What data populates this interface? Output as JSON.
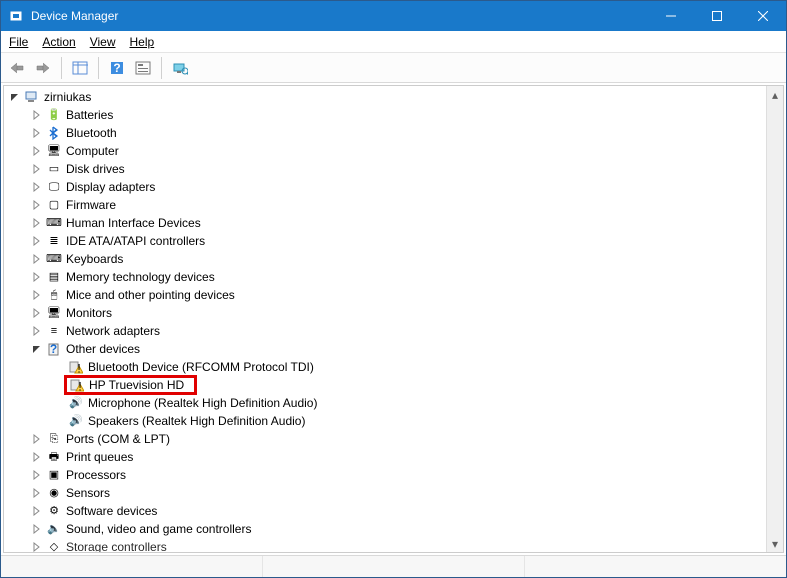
{
  "title": "Device Manager",
  "menus": {
    "file": "File",
    "action": "Action",
    "view": "View",
    "help": "Help"
  },
  "root": "zirniukas",
  "categories": [
    {
      "id": "batteries",
      "label": "Batteries",
      "icon": "battery-icon"
    },
    {
      "id": "bluetooth",
      "label": "Bluetooth",
      "icon": "bluetooth-icon"
    },
    {
      "id": "computer",
      "label": "Computer",
      "icon": "monitor-icon"
    },
    {
      "id": "diskdrives",
      "label": "Disk drives",
      "icon": "drive-icon"
    },
    {
      "id": "displayadapters",
      "label": "Display adapters",
      "icon": "display-adapter-icon"
    },
    {
      "id": "firmware",
      "label": "Firmware",
      "icon": "chip-icon"
    },
    {
      "id": "hid",
      "label": "Human Interface Devices",
      "icon": "hid-icon"
    },
    {
      "id": "ide",
      "label": "IDE ATA/ATAPI controllers",
      "icon": "ide-icon"
    },
    {
      "id": "keyboards",
      "label": "Keyboards",
      "icon": "keyboard-icon"
    },
    {
      "id": "memtech",
      "label": "Memory technology devices",
      "icon": "memory-icon"
    },
    {
      "id": "mice",
      "label": "Mice and other pointing devices",
      "icon": "mouse-icon"
    },
    {
      "id": "monitors",
      "label": "Monitors",
      "icon": "monitor-icon"
    },
    {
      "id": "network",
      "label": "Network adapters",
      "icon": "network-icon"
    },
    {
      "id": "other",
      "label": "Other devices",
      "icon": "question-icon",
      "open": true,
      "children": [
        {
          "id": "bt-rfcomm",
          "label": "Bluetooth Device (RFCOMM Protocol TDI)",
          "icon": "warning-icon"
        },
        {
          "id": "hp-truevision",
          "label": "HP Truevision HD",
          "icon": "warning-icon",
          "highlighted": true
        },
        {
          "id": "mic-realtek",
          "label": "Microphone (Realtek High Definition Audio)",
          "icon": "speaker-icon"
        },
        {
          "id": "spk-realtek",
          "label": "Speakers (Realtek High Definition Audio)",
          "icon": "speaker-icon"
        }
      ]
    },
    {
      "id": "ports",
      "label": "Ports (COM & LPT)",
      "icon": "port-icon"
    },
    {
      "id": "printq",
      "label": "Print queues",
      "icon": "printer-icon"
    },
    {
      "id": "processors",
      "label": "Processors",
      "icon": "cpu-icon"
    },
    {
      "id": "sensors",
      "label": "Sensors",
      "icon": "sensor-icon"
    },
    {
      "id": "software",
      "label": "Software devices",
      "icon": "software-icon"
    },
    {
      "id": "sound",
      "label": "Sound, video and game controllers",
      "icon": "sound-icon"
    },
    {
      "id": "storagectrl",
      "label": "Storage controllers",
      "icon": "storage-icon",
      "truncated": true
    }
  ],
  "icon_glyphs": {
    "battery-icon": "🔋",
    "bluetooth-icon": "",
    "monitor-icon": "🖥",
    "drive-icon": "▭",
    "display-adapter-icon": "🖵",
    "chip-icon": "▢",
    "hid-icon": "⌨",
    "ide-icon": "≣",
    "keyboard-icon": "⌨",
    "memory-icon": "▤",
    "mouse-icon": "🖱",
    "network-icon": "≡",
    "question-icon": "?",
    "warning-icon": "⚠",
    "speaker-icon": "🔊",
    "port-icon": "⎘",
    "printer-icon": "🖶",
    "cpu-icon": "▣",
    "sensor-icon": "◉",
    "software-icon": "⚙",
    "sound-icon": "🔈",
    "storage-icon": "◇",
    "computer-root-icon": "🖳"
  }
}
